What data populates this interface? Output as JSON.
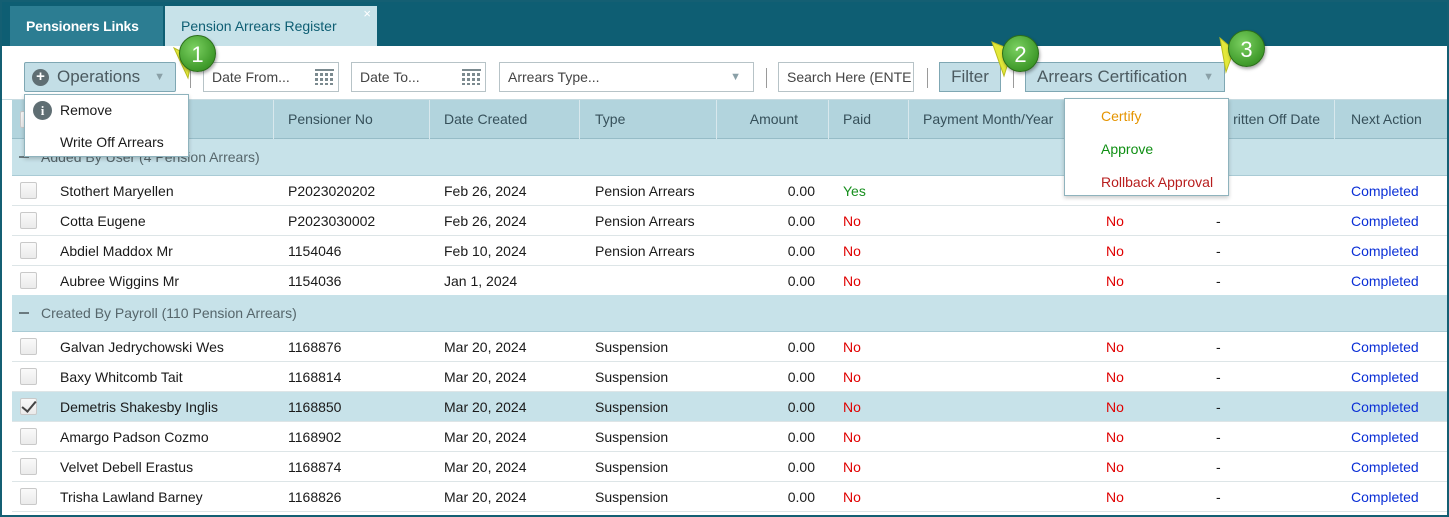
{
  "tabs": [
    {
      "label": "Pensioners Links"
    },
    {
      "label": "Pension Arrears Register",
      "close": "×"
    }
  ],
  "toolbar": {
    "operations_label": "Operations",
    "date_from_placeholder": "Date From...",
    "date_to_placeholder": "Date To...",
    "arrears_type_placeholder": "Arrears Type...",
    "search_placeholder": "Search Here (ENTE",
    "filter_label": "Filter",
    "certification_label": "Arrears Certification"
  },
  "operations_menu": {
    "items": [
      {
        "label": "Remove",
        "icon": "info-icon"
      },
      {
        "label": "Write Off Arrears"
      }
    ]
  },
  "certification_menu": {
    "items": [
      {
        "label": "Certify",
        "color": "#e59400"
      },
      {
        "label": "Approve",
        "color": "#0f8f13"
      },
      {
        "label": "Rollback Approval",
        "color": "#b81d1d"
      }
    ]
  },
  "grid": {
    "columns": [
      "Pensioner No",
      "Date Created",
      "Type",
      "Amount",
      "Paid",
      "Payment Month/Year",
      "ritten Off Date",
      "Next Action"
    ],
    "groups": [
      {
        "label": "Added By User (4 Pension Arrears)",
        "rows": [
          {
            "name": "Stothert Maryellen",
            "pensioner_no": "P2023020202",
            "date": "Feb 26, 2024",
            "type": "Pension Arrears",
            "amount": "0.00",
            "paid": "Yes",
            "written_off": "",
            "written_off_date": "",
            "next": "Completed",
            "checked": false
          },
          {
            "name": "Cotta Eugene",
            "pensioner_no": "P2023030002",
            "date": "Feb 26, 2024",
            "type": "Pension Arrears",
            "amount": "0.00",
            "paid": "No",
            "written_off": "No",
            "written_off_date": "-",
            "next": "Completed",
            "checked": false
          },
          {
            "name": "Abdiel Maddox Mr",
            "pensioner_no": "1154046",
            "date": "Feb 10, 2024",
            "type": "Pension Arrears",
            "amount": "0.00",
            "paid": "No",
            "written_off": "No",
            "written_off_date": "-",
            "next": "Completed",
            "checked": false
          },
          {
            "name": "Aubree Wiggins Mr",
            "pensioner_no": "1154036",
            "date": "Jan 1, 2024",
            "type": "",
            "amount": "0.00",
            "paid": "No",
            "written_off": "No",
            "written_off_date": "-",
            "next": "Completed",
            "checked": false
          }
        ]
      },
      {
        "label": "Created By Payroll (110 Pension Arrears)",
        "rows": [
          {
            "name": "Galvan Jedrychowski Wes",
            "pensioner_no": "1168876",
            "date": "Mar 20, 2024",
            "type": "Suspension",
            "amount": "0.00",
            "paid": "No",
            "written_off": "No",
            "written_off_date": "-",
            "next": "Completed",
            "checked": false
          },
          {
            "name": "Baxy Whitcomb Tait",
            "pensioner_no": "1168814",
            "date": "Mar 20, 2024",
            "type": "Suspension",
            "amount": "0.00",
            "paid": "No",
            "written_off": "No",
            "written_off_date": "-",
            "next": "Completed",
            "checked": false
          },
          {
            "name": "Demetris Shakesby Inglis",
            "pensioner_no": "1168850",
            "date": "Mar 20, 2024",
            "type": "Suspension",
            "amount": "0.00",
            "paid": "No",
            "written_off": "No",
            "written_off_date": "-",
            "next": "Completed",
            "checked": true
          },
          {
            "name": "Amargo Padson Cozmo",
            "pensioner_no": "1168902",
            "date": "Mar 20, 2024",
            "type": "Suspension",
            "amount": "0.00",
            "paid": "No",
            "written_off": "No",
            "written_off_date": "-",
            "next": "Completed",
            "checked": false
          },
          {
            "name": "Velvet Debell Erastus",
            "pensioner_no": "1168874",
            "date": "Mar 20, 2024",
            "type": "Suspension",
            "amount": "0.00",
            "paid": "No",
            "written_off": "No",
            "written_off_date": "-",
            "next": "Completed",
            "checked": false
          },
          {
            "name": "Trisha Lawland Barney",
            "pensioner_no": "1168826",
            "date": "Mar 20, 2024",
            "type": "Suspension",
            "amount": "0.00",
            "paid": "No",
            "written_off": "No",
            "written_off_date": "-",
            "next": "Completed",
            "checked": false
          }
        ]
      }
    ]
  },
  "callouts": [
    "1",
    "2",
    "3"
  ],
  "colors": {
    "header": "#0e5e73",
    "accent": "#c7e2e9",
    "yes": "#178f1e",
    "no": "#e00000",
    "link": "#0a2fd6",
    "callout": "#3f9a2a"
  }
}
